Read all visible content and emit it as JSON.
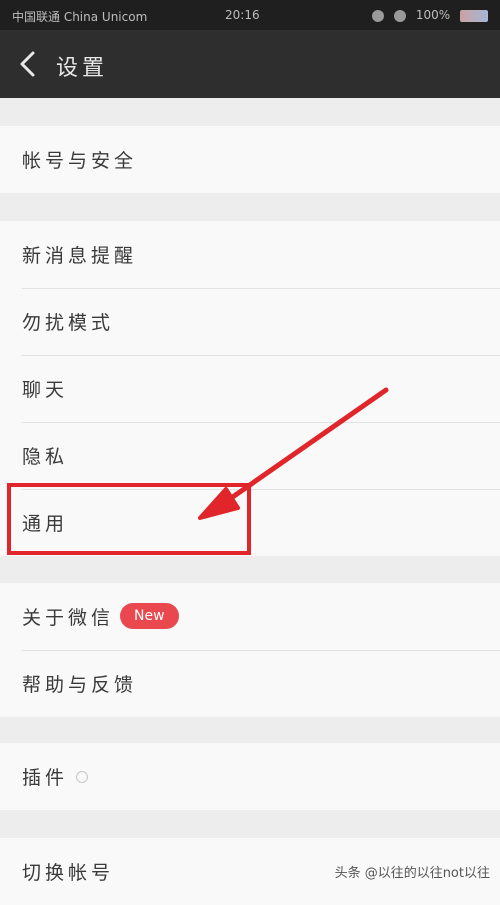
{
  "status_bar": {
    "carrier": "中国联通 China Unicom",
    "time": "20:16",
    "battery": "100%"
  },
  "nav": {
    "title": "设置",
    "back_icon": "chevron-left-icon"
  },
  "groups": [
    {
      "items": [
        {
          "label": "帐号与安全"
        }
      ]
    },
    {
      "items": [
        {
          "label": "新消息提醒"
        },
        {
          "label": "勿扰模式"
        },
        {
          "label": "聊天"
        },
        {
          "label": "隐私"
        },
        {
          "label": "通用"
        }
      ]
    },
    {
      "items": [
        {
          "label": "关于微信",
          "badge": "New"
        },
        {
          "label": "帮助与反馈"
        }
      ]
    },
    {
      "items": [
        {
          "label": "插件",
          "icon": "circle-icon"
        }
      ]
    },
    {
      "items": [
        {
          "label": "切换帐号"
        }
      ]
    }
  ],
  "watermark": "头条 @以往的以往not以往",
  "colors": {
    "nav_bg": "#2e2e2e",
    "badge": "#e8484e",
    "annotation": "#e0262a"
  }
}
